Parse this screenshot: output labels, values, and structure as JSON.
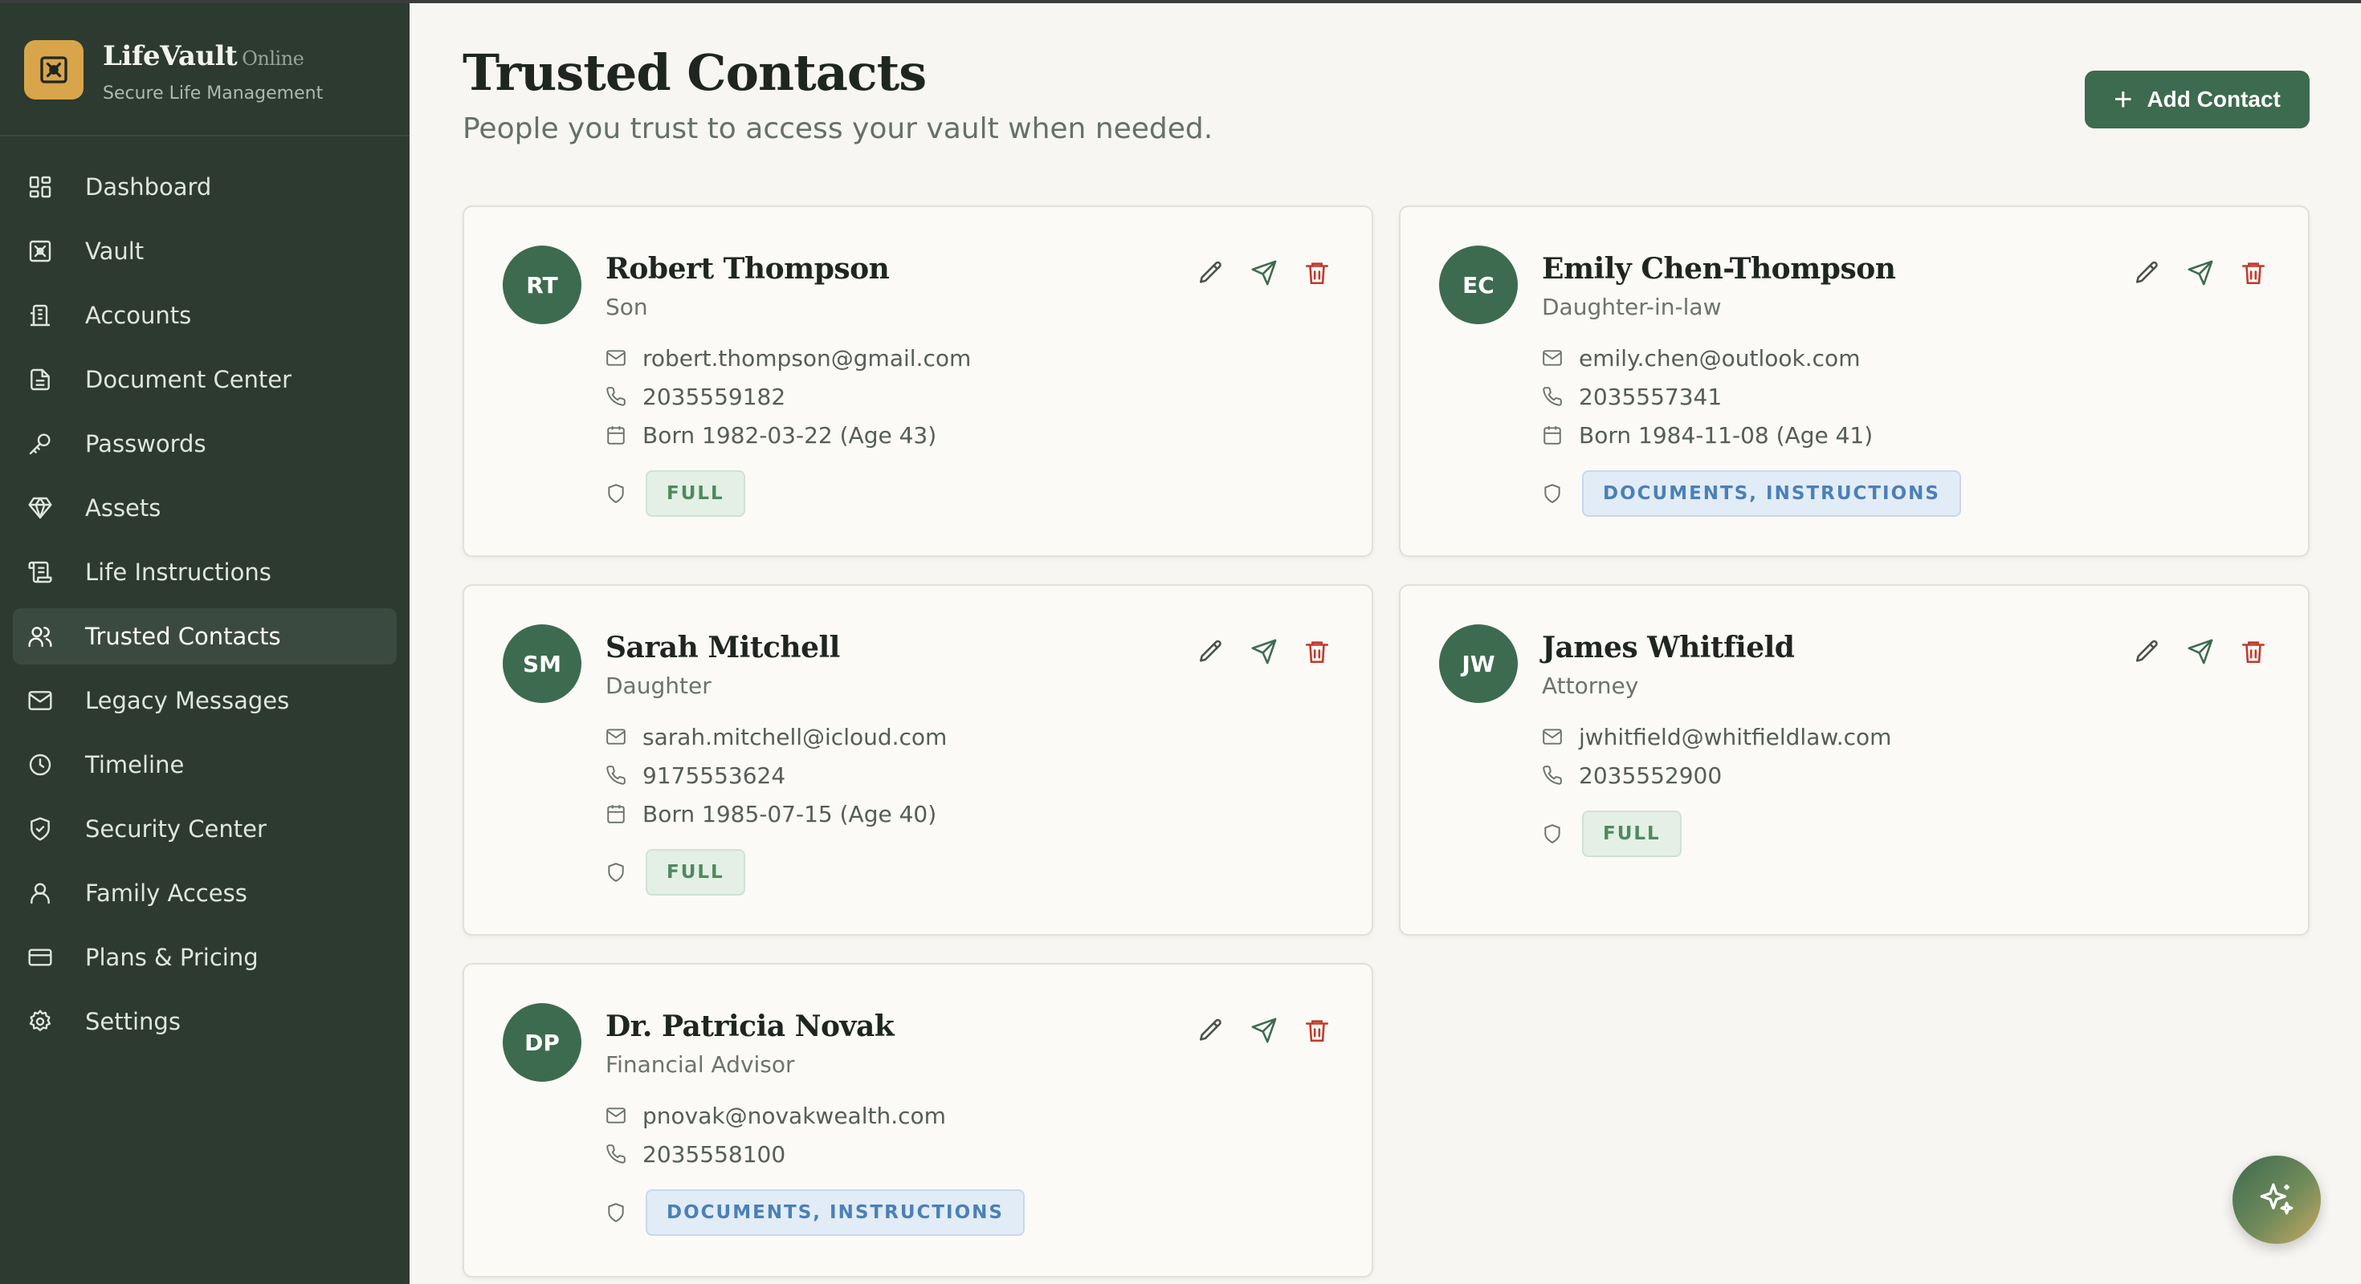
{
  "brand": {
    "name": "LifeVault",
    "status": "Online",
    "tagline": "Secure Life Management"
  },
  "nav": [
    {
      "label": "Dashboard",
      "icon": "dashboard-icon"
    },
    {
      "label": "Vault",
      "icon": "vault-icon"
    },
    {
      "label": "Accounts",
      "icon": "accounts-icon"
    },
    {
      "label": "Document Center",
      "icon": "document-icon"
    },
    {
      "label": "Passwords",
      "icon": "key-icon"
    },
    {
      "label": "Assets",
      "icon": "gem-icon"
    },
    {
      "label": "Life Instructions",
      "icon": "scroll-icon"
    },
    {
      "label": "Trusted Contacts",
      "icon": "users-icon",
      "active": true
    },
    {
      "label": "Legacy Messages",
      "icon": "mail-icon"
    },
    {
      "label": "Timeline",
      "icon": "clock-icon"
    },
    {
      "label": "Security Center",
      "icon": "shield-check-icon"
    },
    {
      "label": "Family Access",
      "icon": "user-icon"
    },
    {
      "label": "Plans & Pricing",
      "icon": "credit-card-icon"
    },
    {
      "label": "Settings",
      "icon": "gear-icon"
    }
  ],
  "header": {
    "title": "Trusted Contacts",
    "subtitle": "People you trust to access your vault when needed.",
    "add_button": "Add Contact"
  },
  "contacts": [
    {
      "initials": "RT",
      "name": "Robert Thompson",
      "relation": "Son",
      "email": "robert.thompson@gmail.com",
      "phone": "2035559182",
      "born": "Born 1982-03-22 (Age 43)",
      "access": "FULL",
      "access_type": "full"
    },
    {
      "initials": "EC",
      "name": "Emily Chen-Thompson",
      "relation": "Daughter-in-law",
      "email": "emily.chen@outlook.com",
      "phone": "2035557341",
      "born": "Born 1984-11-08 (Age 41)",
      "access": "DOCUMENTS, INSTRUCTIONS",
      "access_type": "docs"
    },
    {
      "initials": "SM",
      "name": "Sarah Mitchell",
      "relation": "Daughter",
      "email": "sarah.mitchell@icloud.com",
      "phone": "9175553624",
      "born": "Born 1985-07-15 (Age 40)",
      "access": "FULL",
      "access_type": "full"
    },
    {
      "initials": "JW",
      "name": "James Whitfield",
      "relation": "Attorney",
      "email": "jwhitfield@whitfieldlaw.com",
      "phone": "2035552900",
      "born": null,
      "access": "FULL",
      "access_type": "full"
    },
    {
      "initials": "DP",
      "name": "Dr. Patricia Novak",
      "relation": "Financial Advisor",
      "email": "pnovak@novakwealth.com",
      "phone": "2035558100",
      "born": null,
      "access": "DOCUMENTS, INSTRUCTIONS",
      "access_type": "docs"
    }
  ],
  "colors": {
    "sidebar": "#2c3a30",
    "accent": "#3d6b4f",
    "brand_logo": "#d8a54a",
    "delete": "#c0392b"
  },
  "fab": {
    "icon": "sparkles-icon"
  }
}
